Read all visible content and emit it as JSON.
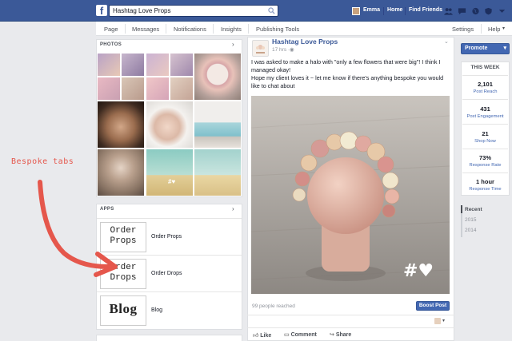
{
  "topbar": {
    "logo": "f",
    "search_value": "Hashtag Love Props",
    "user_name": "Emma",
    "home_label": "Home",
    "find_friends_label": "Find Friends"
  },
  "page_tabs": [
    "Page",
    "Messages",
    "Notifications",
    "Insights",
    "Publishing Tools"
  ],
  "page_tabs_right": {
    "settings": "Settings",
    "help": "Help"
  },
  "photos": {
    "header": "PHOTOS"
  },
  "apps": {
    "header": "APPS",
    "items": [
      {
        "thumb_line1": "Order",
        "thumb_line2": "Props",
        "label": "Order Props"
      },
      {
        "thumb_line1": "Order",
        "thumb_line2": "Drops",
        "label": "Order Drops"
      },
      {
        "thumb_line1": "Blog",
        "thumb_line2": "",
        "label": "Blog"
      }
    ]
  },
  "annotation": "Bespoke tabs",
  "post": {
    "page_name": "Hashtag Love Props",
    "time": "17 hrs",
    "text_line1": "I was asked to make a halo with \"only a few flowers that were big\"! I think I managed okay!",
    "text_line2": "Hope my client loves it ~ let me know if there's anything bespoke you would like to chat about",
    "watermark": "#♥",
    "reached": "99 people reached",
    "boost_label": "Boost Post",
    "like": "Like",
    "comment": "Comment",
    "share": "Share"
  },
  "right": {
    "promote_label": "Promote",
    "week_header": "THIS WEEK",
    "stats": [
      {
        "value": "2,101",
        "label": "Post Reach"
      },
      {
        "value": "431",
        "label": "Post Engagement"
      },
      {
        "value": "21",
        "label": "Shop Now"
      },
      {
        "value": "73%",
        "label": "Response Rate"
      },
      {
        "value": "1 hour",
        "label": "Response Time"
      }
    ],
    "timeline": [
      "Recent",
      "2015",
      "2014"
    ]
  },
  "colors": {
    "brand": "#3b5998",
    "accent": "#4267b2",
    "annotation": "#e5574c"
  }
}
